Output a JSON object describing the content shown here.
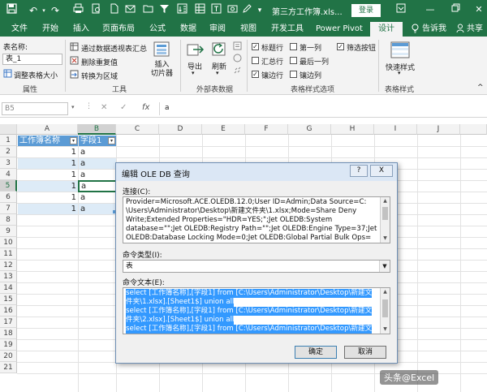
{
  "titlebar": {
    "title": "第三方工作簿.xls...",
    "login": "登录",
    "qa_icons": [
      "save-icon",
      "undo-icon",
      "redo-icon",
      "print-icon",
      "print-preview-icon",
      "new-icon",
      "filter-icon",
      "sort-icon",
      "form-icon"
    ]
  },
  "tabs": [
    "文件",
    "开始",
    "插入",
    "页面布局",
    "公式",
    "数据",
    "审阅",
    "视图",
    "开发工具",
    "Power Pivot",
    "设计",
    "告诉我",
    "共享"
  ],
  "ribbon": {
    "table_name_label": "表名称:",
    "table_name_value": "表_1",
    "resize_table": "调整表格大小",
    "group_properties": "属性",
    "summarize_pivot": "通过数据透视表汇总",
    "remove_duplicates": "删除重复值",
    "convert_to_range": "转换为区域",
    "group_tools": "工具",
    "insert_slicer": "插入\n切片器",
    "export": "导出",
    "refresh": "刷新",
    "group_external": "外部表数据",
    "opts": {
      "header_row": "标题行",
      "total_row": "汇总行",
      "banded_rows": "镶边行",
      "first_column": "第一列",
      "last_column": "最后一列",
      "banded_columns": "镶边列",
      "filter_button": "筛选按钮"
    },
    "group_style_opts": "表格样式选项",
    "quick_styles": "快速样式",
    "group_styles": "表格样式"
  },
  "formula_bar": {
    "namebox": "B5",
    "fx": "fx",
    "content": "a"
  },
  "grid": {
    "columns": [
      "A",
      "B",
      "C",
      "D",
      "E",
      "F",
      "G",
      "H",
      "I",
      "J"
    ],
    "rows": [
      "1",
      "2",
      "3",
      "4",
      "5",
      "6",
      "7",
      "8",
      "9",
      "10",
      "11",
      "12",
      "13",
      "14",
      "15",
      "16",
      "17",
      "18",
      "19",
      "20",
      "21"
    ],
    "header_a": "工作簿名称",
    "header_b": "字段1",
    "data": [
      {
        "a": "1",
        "b": "a"
      },
      {
        "a": "1",
        "b": "a"
      },
      {
        "a": "1",
        "b": "a"
      },
      {
        "a": "1",
        "b": "a"
      },
      {
        "a": "1",
        "b": "a"
      },
      {
        "a": "1",
        "b": "a"
      }
    ]
  },
  "dialog": {
    "title": "编辑 OLE DB 查询",
    "help": "?",
    "close": "X",
    "conn_label": "连接(C):",
    "conn_lines": [
      "Provider=Microsoft.ACE.OLEDB.12.0;User ID=Admin;Data Source=C:",
      "\\Users\\Administrator\\Desktop\\新建文件夹\\1.xlsx;Mode=Share Deny",
      "Write;Extended Properties=\"HDR=YES;\";Jet OLEDB:System",
      "database=\"\";Jet OLEDB:Registry Path=\"\";Jet OLEDB:Engine Type=37;Jet",
      "OLEDB:Database Locking Mode=0;Jet OLEDB:Global Partial Bulk Ops="
    ],
    "cmdtype_label": "命令类型(I):",
    "cmdtype_value": "表",
    "cmdtext_label": "命令文本(E):",
    "cmd_lines": [
      "select [工作簿名称],[字段1] from [C:\\Users\\Administrator\\Desktop\\新建文",
      "件夹\\1.xlsx].[Sheet1$] union all",
      "select [工作簿名称],[字段1] from [C:\\Users\\Administrator\\Desktop\\新建文",
      "件夹\\2.xlsx].[Sheet1$] union all",
      "select [工作簿名称],[字段1] from [C:\\Users\\Administrator\\Desktop\\新建文"
    ],
    "ok": "确定",
    "cancel": "取消"
  },
  "watermark": "头条@Excel",
  "colors": {
    "excel_green": "#217346",
    "selection_blue": "#3399ff",
    "table_header_blue": "#5b9bd5",
    "table_band_blue": "#ddebf7"
  }
}
